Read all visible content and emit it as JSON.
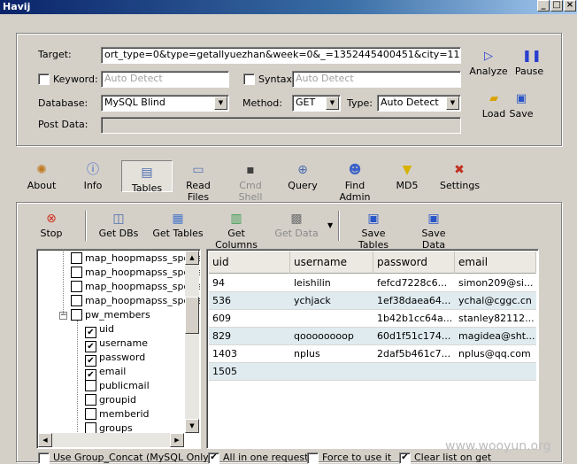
{
  "window": {
    "title": "Havij"
  },
  "form": {
    "target_label": "Target:",
    "target_value": "ort_type=0&type=getallyuezhan&week=0&_=1352445400451&city=11",
    "keyword_label": "Keyword:",
    "keyword_value": "Auto Detect",
    "syntax_label": "Syntax:",
    "syntax_value": "Auto Detect",
    "database_label": "Database:",
    "database_value": "MySQL Blind",
    "method_label": "Method:",
    "method_value": "GET",
    "type_label": "Type:",
    "type_value": "Auto Detect",
    "postdata_label": "Post Data:"
  },
  "actions": {
    "analyze": "Analyze",
    "pause": "Pause",
    "load": "Load",
    "save": "Save"
  },
  "tabs": [
    "About",
    "Info",
    "Tables",
    "Read Files",
    "Cmd Shell",
    "Query",
    "Find Admin",
    "MD5",
    "Settings"
  ],
  "toolbar": {
    "stop": "Stop",
    "get_dbs": "Get DBs",
    "get_tables": "Get Tables",
    "get_columns": "Get Columns",
    "get_data": "Get Data",
    "save_tables": "Save Tables",
    "save_data": "Save Data"
  },
  "tree": {
    "items": [
      {
        "label": "map_hoopmapss_sports",
        "checked": false
      },
      {
        "label": "map_hoopmapss_sports",
        "checked": false
      },
      {
        "label": "map_hoopmapss_sports",
        "checked": false
      },
      {
        "label": "map_hoopmapss_sports",
        "checked": false
      },
      {
        "label": "pw_members",
        "checked": false
      },
      {
        "label": "uid",
        "checked": true
      },
      {
        "label": "username",
        "checked": true
      },
      {
        "label": "password",
        "checked": true
      },
      {
        "label": "email",
        "checked": true
      },
      {
        "label": "publicmail",
        "checked": false
      },
      {
        "label": "groupid",
        "checked": false
      },
      {
        "label": "memberid",
        "checked": false
      },
      {
        "label": "groups",
        "checked": false
      }
    ]
  },
  "grid": {
    "columns": [
      "uid",
      "username",
      "password",
      "email"
    ],
    "rows": [
      [
        "94",
        "leishilin",
        "fefcd7228c6...",
        "simon209@si..."
      ],
      [
        "536",
        "ychjack",
        "1ef38daea64...",
        "ychal@cggc.cn"
      ],
      [
        "609",
        "",
        "1b42b1cc64a...",
        "stanley82112..."
      ],
      [
        "829",
        "qoooooooop",
        "60d1f51c174...",
        "magidea@sht..."
      ],
      [
        "1403",
        "nplus",
        "2daf5b461c7...",
        "nplus@qq.com"
      ],
      [
        "1505",
        "",
        "",
        ""
      ]
    ]
  },
  "options": {
    "group_concat": "Use Group_Concat (MySQL Only)",
    "all_in_one": "All in one request",
    "force": "Force to use it",
    "clear_list": "Clear list on get"
  },
  "watermark": "www.wooyun.org"
}
